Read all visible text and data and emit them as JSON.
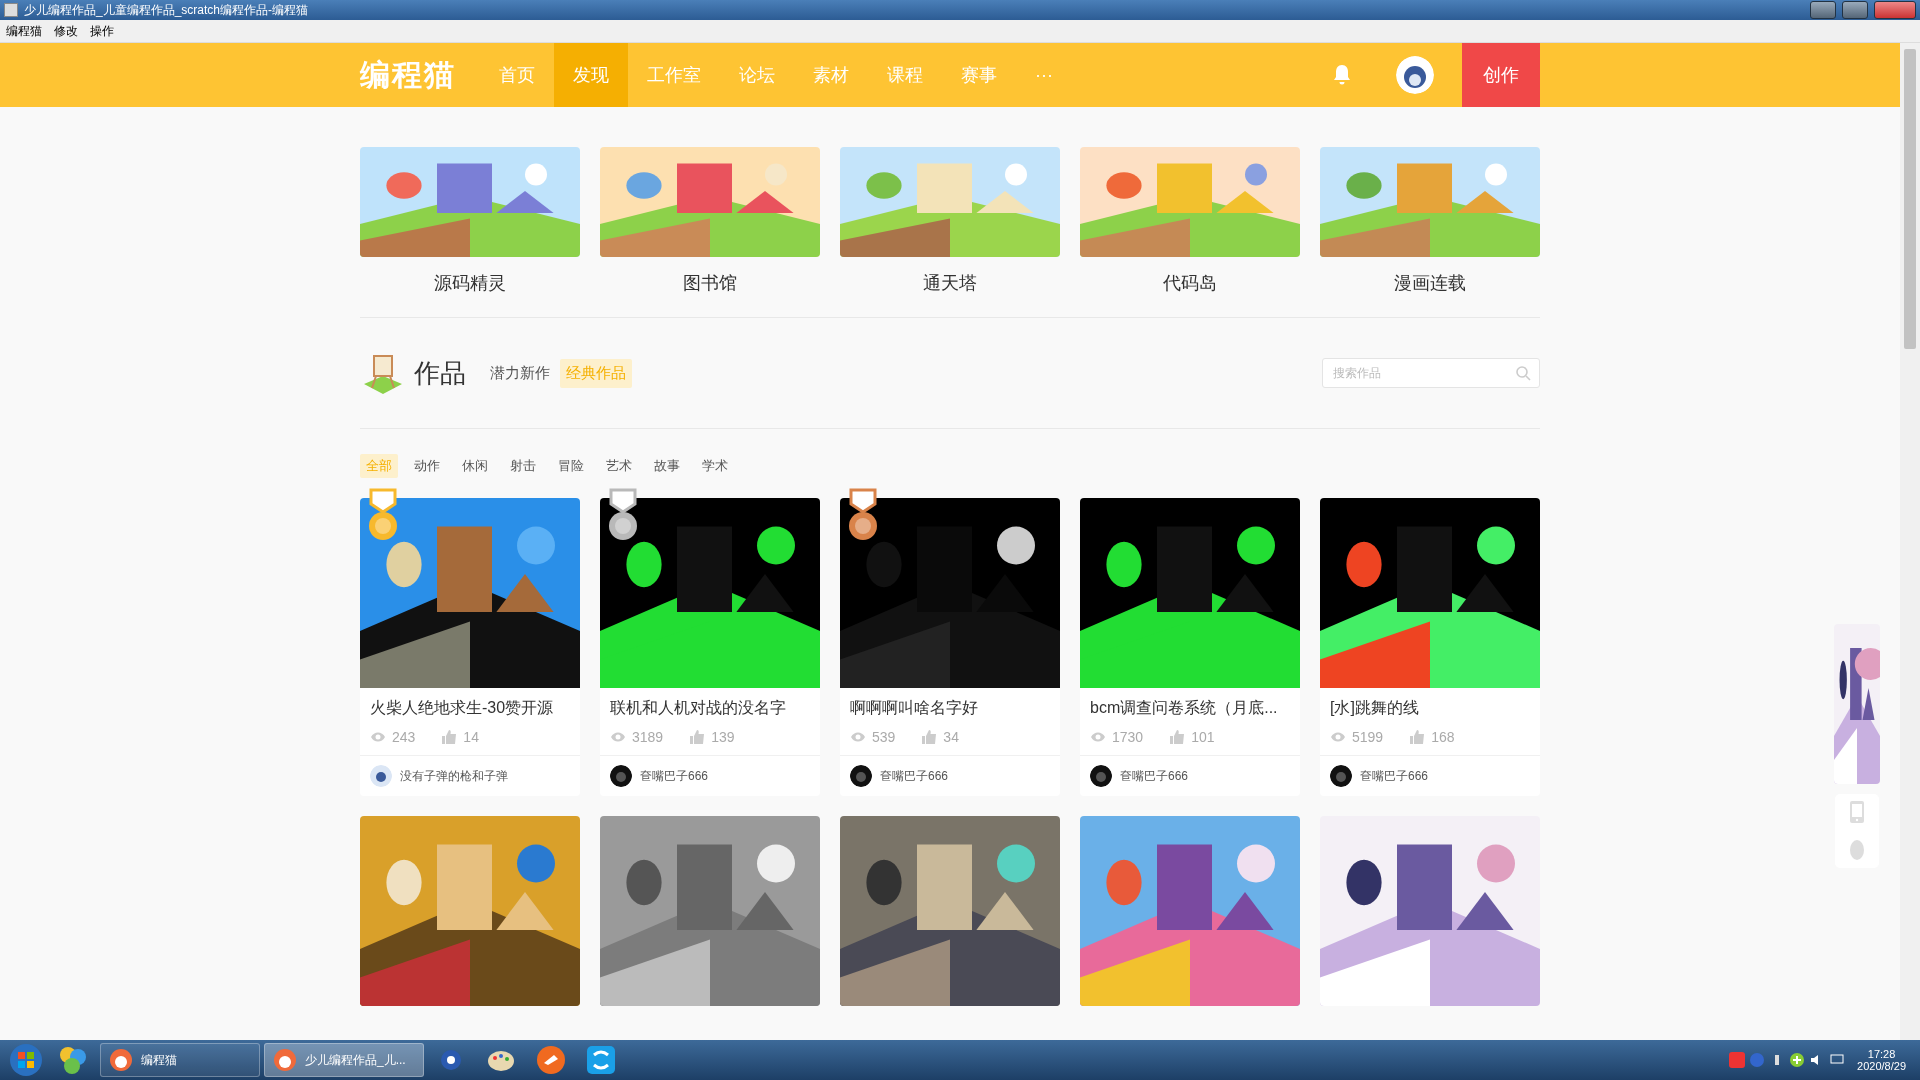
{
  "window": {
    "title": "少儿编程作品_儿童编程作品_scratch编程作品-编程猫"
  },
  "menu_bar": [
    "编程猫",
    "修改",
    "操作"
  ],
  "nav": {
    "logo": "编程猫",
    "items": [
      {
        "label": "首页",
        "selected": false
      },
      {
        "label": "发现",
        "selected": true
      },
      {
        "label": "工作室",
        "selected": false
      },
      {
        "label": "论坛",
        "selected": false
      },
      {
        "label": "素材",
        "selected": false
      },
      {
        "label": "课程",
        "selected": false
      },
      {
        "label": "赛事",
        "selected": false
      },
      {
        "label": "···",
        "selected": false
      }
    ],
    "create_button": "创作"
  },
  "categories": [
    {
      "label": "源码精灵",
      "kind": "picture"
    },
    {
      "label": "图书馆",
      "kind": "picture"
    },
    {
      "label": "通天塔",
      "kind": "picture"
    },
    {
      "label": "代码岛",
      "kind": "picture"
    },
    {
      "label": "漫画连载",
      "kind": "picture"
    }
  ],
  "works": {
    "title": "作品",
    "tabs": [
      {
        "label": "潜力新作",
        "selected": false
      },
      {
        "label": "经典作品",
        "selected": true
      }
    ],
    "search": {
      "placeholder": "搜索作品"
    },
    "filters": [
      {
        "label": "全部",
        "selected": true
      },
      {
        "label": "动作",
        "selected": false
      },
      {
        "label": "休闲",
        "selected": false
      },
      {
        "label": "射击",
        "selected": false
      },
      {
        "label": "冒险",
        "selected": false
      },
      {
        "label": "艺术",
        "selected": false
      },
      {
        "label": "故事",
        "selected": false
      },
      {
        "label": "学术",
        "selected": false
      }
    ],
    "cards": [
      {
        "title": "火柴人绝地求生-30赞开源",
        "views": "243",
        "likes": "14",
        "author": "没有子弹的枪和子弹",
        "medal": {
          "color": "#f7b92c"
        },
        "kind": "work"
      },
      {
        "title": "联机和人机对战的没名字",
        "views": "3189",
        "likes": "139",
        "author": "奆嘴巴子666",
        "medal": {
          "color": "#b9b9b9"
        },
        "kind": "work"
      },
      {
        "title": "啊啊啊叫啥名字好",
        "views": "539",
        "likes": "34",
        "author": "奆嘴巴子666",
        "medal": {
          "color": "#d9834a"
        },
        "kind": "work"
      },
      {
        "title": "bcm调查问卷系统（月底...",
        "views": "1730",
        "likes": "101",
        "author": "奆嘴巴子666",
        "kind": "work"
      },
      {
        "title": "[水]跳舞的线",
        "views": "5199",
        "likes": "168",
        "author": "奆嘴巴子666",
        "kind": "work"
      },
      {
        "kind": "picture"
      },
      {
        "kind": "picture"
      },
      {
        "kind": "picture"
      },
      {
        "kind": "picture"
      },
      {
        "kind": "picture"
      }
    ]
  },
  "taskbar": {
    "windows": [
      {
        "label": "编程猫",
        "selected": false
      },
      {
        "label": "少儿编程作品_儿...",
        "selected": true
      }
    ],
    "time": "17:28",
    "date": "2020/8/29"
  }
}
